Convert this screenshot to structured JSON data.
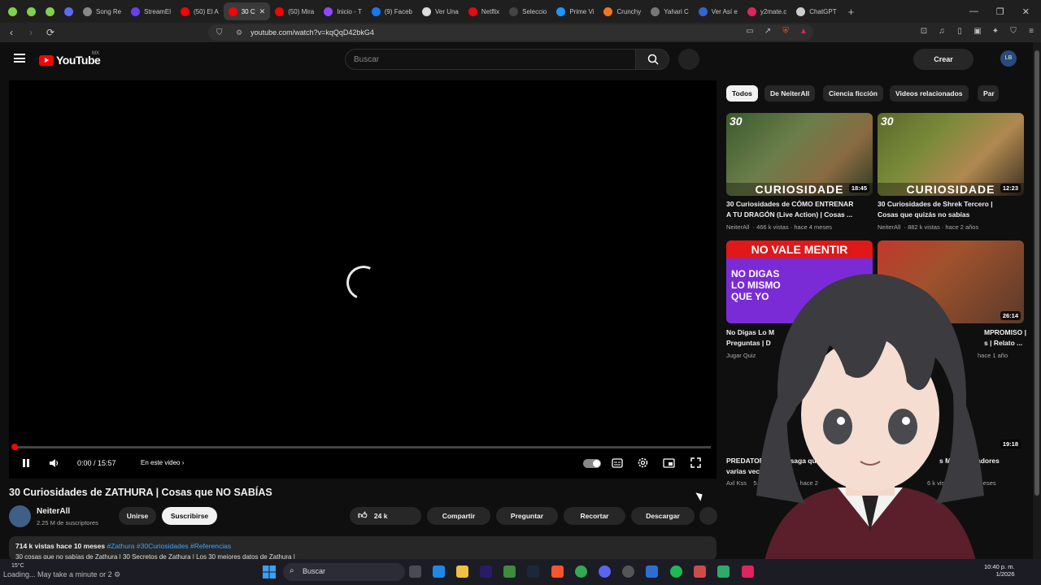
{
  "tabs": [
    {
      "label": "",
      "color": "#7dd34a"
    },
    {
      "label": "",
      "color": "#7dd34a"
    },
    {
      "label": "",
      "color": "#7dd34a"
    },
    {
      "label": "",
      "color": "#5b6cf0"
    },
    {
      "label": "Song Re",
      "color": "#888888"
    },
    {
      "label": "StreamEl",
      "color": "#6a3df0"
    },
    {
      "label": "(50) El A",
      "color": "#ff0000"
    },
    {
      "label": "30 C",
      "color": "#ff0000",
      "active": true
    },
    {
      "label": "(50) Mira",
      "color": "#ff0000"
    },
    {
      "label": "Inicio - T",
      "color": "#9146ff"
    },
    {
      "label": "(9) Faceb",
      "color": "#1877f2"
    },
    {
      "label": "Ver Una",
      "color": "#dddddd"
    },
    {
      "label": "Netflix",
      "color": "#e50914"
    },
    {
      "label": "Seleccio",
      "color": "#444444"
    },
    {
      "label": "Prime Vi",
      "color": "#1a98ff"
    },
    {
      "label": "Crunchy",
      "color": "#f47521"
    },
    {
      "label": "Yahari C",
      "color": "#777777"
    },
    {
      "label": "Ver Así e",
      "color": "#3366cc"
    },
    {
      "label": "y2mate.c",
      "color": "#e0245e"
    },
    {
      "label": "ChatGPT",
      "color": "#cccccc"
    }
  ],
  "url": "youtube.com/watch?v=kqQqD42bkG4",
  "header": {
    "logo": "YouTube",
    "country": "MX",
    "search_placeholder": "Buscar",
    "create": "Crear",
    "avatar": "LB"
  },
  "player": {
    "time": "0:00 / 15:57",
    "chapters": "En este video",
    "progress": 0.0
  },
  "video": {
    "title": "30 Curiosidades de ZATHURA | Cosas que NO SABÍAS",
    "channel": "NeiterAll",
    "subs": "2.25 M de suscriptores",
    "join": "Unirse",
    "subscribe": "Suscribirse",
    "likes": "24 k",
    "share": "Compartir",
    "ask": "Preguntar",
    "clip": "Recortar",
    "download": "Descargar",
    "views_date": "714 k vistas  hace 10 meses",
    "tags": "#Zathura #30Curiosidades #Referencias",
    "desc_line": "30 cosas que no sabías de Zathura | 30 Secretos de Zathura | Los 30 mejores datos de Zathura |"
  },
  "chips": [
    "Todos",
    "De NeiterAll",
    "Ciencia ficción",
    "Videos relacionados",
    "Par"
  ],
  "recs": [
    {
      "title1": "30 Curiosidades de CÓMO ENTRENAR",
      "title2": "A TU DRAGÓN (Live Action) | Cosas ...",
      "channel": "NeiterAll",
      "meta": "466 k vistas · hace 4 meses",
      "duration": "18:45",
      "num": "30",
      "caption": "CURIOSIDADE"
    },
    {
      "title1": "30 Curiosidades de Shrek Tercero |",
      "title2": "Cosas que quizás no sabías",
      "channel": "NeiterAll",
      "meta": "882 k vistas · hace 2 años",
      "duration": "12:23",
      "num": "30",
      "caption": "CURIOSIDADE"
    },
    {
      "title1": "No Digas Lo M",
      "title2": "Preguntas | D",
      "channel": "Jugar Quiz",
      "meta": "",
      "duration": "",
      "top": "NO VALE MENTIR",
      "mid": "NO DIGAS LO MISMO QUE YO"
    },
    {
      "title1": "MPROMISO |",
      "title2": "s | Relato ...",
      "channel": "",
      "meta": "hace 1 año",
      "duration": "26:14"
    },
    {
      "title1": "PREDATOR es una saga que",
      "title2": "varias veces.",
      "channel": "Axl Kss",
      "meta": "5.8 M de vistas · hace 2",
      "duration": ""
    },
    {
      "title1": "s Más Aterradores",
      "title2": "",
      "channel": "",
      "meta": "6 k vistas · hace 2 meses",
      "duration": "19:18"
    }
  ],
  "taskbar": {
    "loading": "Loading... May take a minute or 2 ⚙",
    "weather": "15°C",
    "search": "Buscar",
    "time": "10:40 p. m.",
    "date": "1/2026"
  }
}
